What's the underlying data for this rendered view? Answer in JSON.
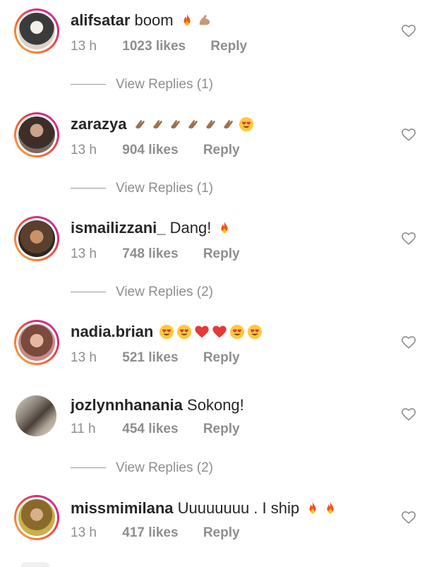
{
  "comments": [
    {
      "username": "alifsatar",
      "text": "boom",
      "emojis": [
        "fire",
        "flexed-biceps"
      ],
      "time": "13 h",
      "likes": "1023 likes",
      "reply": "Reply",
      "view_replies": "View Replies (1)",
      "story_ring": true,
      "avatar_color": "#3b3b3b"
    },
    {
      "username": "zarazya",
      "text": "",
      "emojis": [
        "clap",
        "clap",
        "clap",
        "clap",
        "clap",
        "clap",
        "heart-eyes"
      ],
      "time": "13 h",
      "likes": "904 likes",
      "reply": "Reply",
      "view_replies": "View Replies (1)",
      "story_ring": true,
      "avatar_color": "#5a4a44"
    },
    {
      "username": "ismailizzani_",
      "text": "Dang!",
      "emojis": [
        "fire"
      ],
      "time": "13 h",
      "likes": "748 likes",
      "reply": "Reply",
      "view_replies": "View Replies (2)",
      "story_ring": true,
      "avatar_color": "#6b5440"
    },
    {
      "username": "nadia.brian",
      "text": "",
      "emojis": [
        "heart-eyes",
        "heart-eyes",
        "red-heart",
        "red-heart",
        "heart-eyes",
        "heart-eyes"
      ],
      "time": "13 h",
      "likes": "521 likes",
      "reply": "Reply",
      "view_replies": "",
      "story_ring": true,
      "avatar_color": "#9c6a5a"
    },
    {
      "username": "jozlynnhanania",
      "text": "Sokong!",
      "emojis": [],
      "time": "11 h",
      "likes": "454 likes",
      "reply": "Reply",
      "view_replies": "View Replies (2)",
      "story_ring": false,
      "avatar_color": "#8a8278"
    },
    {
      "username": "missmimilana",
      "text": "Uuuuuuuu . I ship",
      "emojis": [
        "fire",
        "fire"
      ],
      "time": "13 h",
      "likes": "417 likes",
      "reply": "Reply",
      "view_replies": "",
      "story_ring": true,
      "avatar_color": "#b89a4a"
    }
  ],
  "icons": {
    "like": "heart-outline-icon"
  },
  "colors": {
    "text_primary": "#262626",
    "text_secondary": "#8e8e8e",
    "story_ring_start": "#f9b13a",
    "story_ring_end": "#c03ab0"
  }
}
